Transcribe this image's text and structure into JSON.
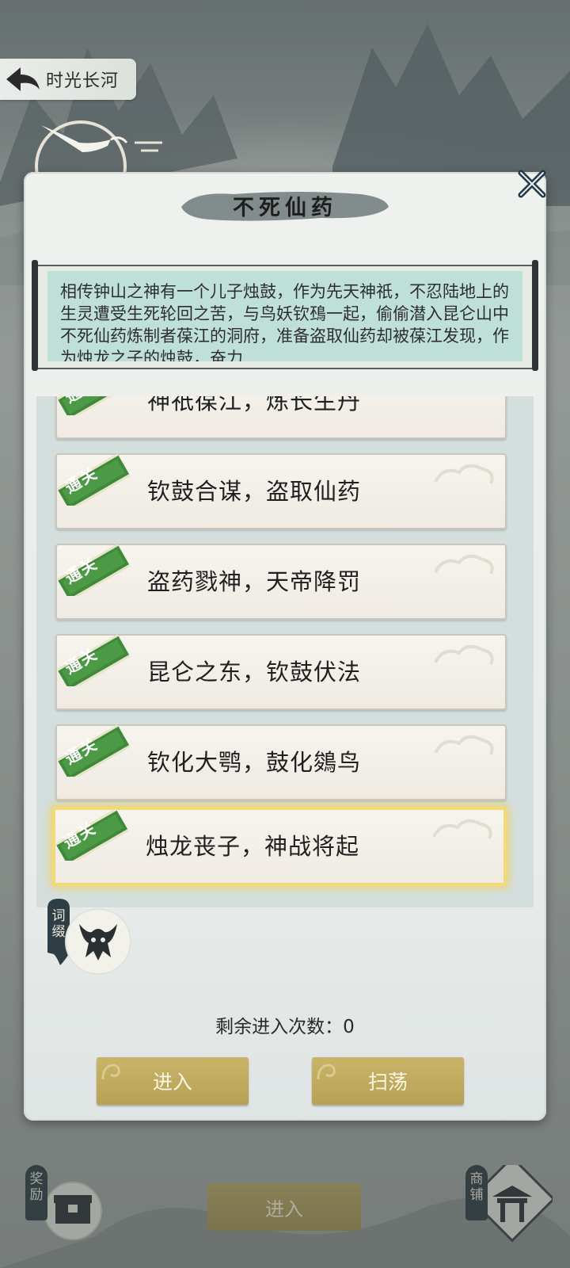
{
  "header": {
    "back_icon": "back-arrow-icon",
    "title": "时光长河"
  },
  "dialog": {
    "title": "不死仙药",
    "close_icon": "close-x-icon",
    "description": "相传钟山之神有一个儿子烛鼓，作为先天神祇，不忍陆地上的生灵遭受生死轮回之苦，与鸟妖钦䲹一起，偷偷潜入昆仑山中不死仙药炼制者葆江的洞府，准备盗取仙药却被葆江发现，作为烛龙之子的烛鼓，奋力",
    "stages": [
      {
        "name": "神祇葆江，炼长生丹",
        "badge": "通关"
      },
      {
        "name": "钦鼓合谋，盗取仙药",
        "badge": "通关"
      },
      {
        "name": "盗药戮神，天帝降罚",
        "badge": "通关"
      },
      {
        "name": "昆仑之东，钦鼓伏法",
        "badge": "通关"
      },
      {
        "name": "钦化大鹗，鼓化鵕鸟",
        "badge": "通关"
      },
      {
        "name": "烛龙丧子，神战将起",
        "badge": "通关",
        "selected": true
      }
    ],
    "affix": {
      "tag": "词缀",
      "icon": "beast-mask-icon"
    },
    "remaining_label": "剩余进入次数：",
    "remaining_count": "0",
    "enter_button": "进入",
    "sweep_button": "扫荡"
  },
  "bottom_bar": {
    "reward_tag": "奖励",
    "enter_button": "进入",
    "shop_tag": "商铺"
  },
  "colors": {
    "gold_button": "#c0aa5f",
    "badge_green": "#3f8a3a",
    "selected_glow": "#f2db77",
    "scroll_teal": "#bfe0d9"
  }
}
